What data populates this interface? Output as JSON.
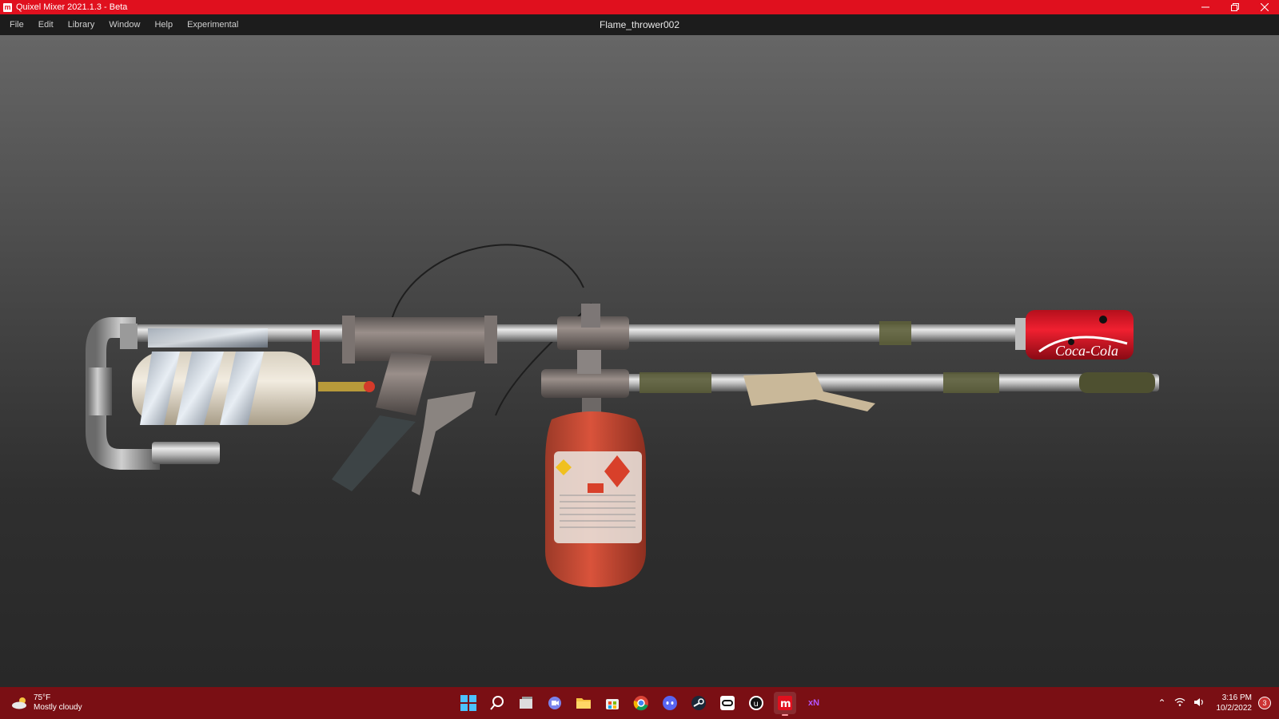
{
  "window": {
    "app_title": "Quixel Mixer 2021.1.3 - Beta",
    "minimize_icon": "minimize-icon",
    "maximize_icon": "restore-icon",
    "close_icon": "close-icon"
  },
  "menu": {
    "items": [
      "File",
      "Edit",
      "Library",
      "Window",
      "Help",
      "Experimental"
    ],
    "document_title": "Flame_thrower002"
  },
  "viewport": {
    "scene": "3D model viewport showing a flamethrower asset"
  },
  "taskbar": {
    "weather_temp": "75°F",
    "weather_desc": "Mostly cloudy",
    "apps": [
      "windows-start-icon",
      "search-icon",
      "task-view-icon",
      "teams-chat-icon",
      "file-explorer-icon",
      "store-icon",
      "chrome-icon",
      "discord-icon",
      "steam-icon",
      "oculus-icon",
      "unreal-engine-icon",
      "quixel-mixer-icon",
      "xnormal-icon"
    ],
    "xn_label": "xN",
    "time": "3:16 PM",
    "date": "10/2/2022",
    "notification_count": "3",
    "colors": {
      "taskbar": "#7a0f14",
      "titlebar": "#e0101e"
    }
  }
}
